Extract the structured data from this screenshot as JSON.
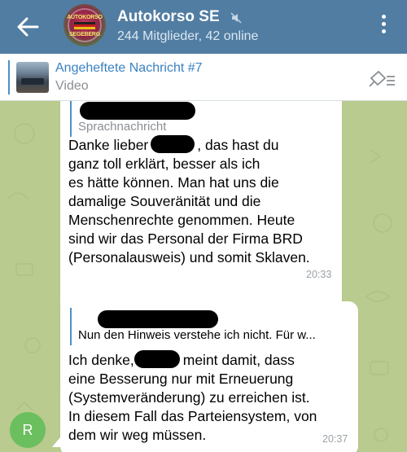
{
  "header": {
    "title": "Autokorso SE",
    "subtitle": "244 Mitglieder, 42 online",
    "avatar_text_top": "AUTOKORSO",
    "avatar_text_bottom": "SEGEBERG",
    "bg_color": "#517da2"
  },
  "pinned": {
    "title": "Angeheftete Nachricht #7",
    "type": "Video"
  },
  "messages": [
    {
      "reply_preview": "Sprachnachricht",
      "lines": [
        "Danke lieber",
        "ganz toll erklärt, besser als ich",
        "es hätte können. Man hat uns die",
        "damalige Souveränität und die",
        "Menschenrechte genommen. Heute",
        "sind wir das Personal der Firma BRD",
        "(Personalausweis) und somit Sklaven."
      ],
      "line1_suffix": ", das hast du",
      "time": "20:33"
    },
    {
      "reply_preview": "Nun den Hinweis verstehe ich nicht. Für w...",
      "lines": [
        "Ich denke,",
        "eine Besserung nur mit Erneuerung",
        "(Systemveränderung) zu erreichen ist.",
        "In diesem Fall das Parteiensystem, von",
        "dem wir weg müssen."
      ],
      "line1_suffix": "meint damit, dass",
      "time": "20:37"
    }
  ],
  "user_avatar_letter": "R",
  "icons": [
    "back-arrow-icon",
    "mute-icon",
    "more-vert-icon",
    "unpin-icon"
  ]
}
